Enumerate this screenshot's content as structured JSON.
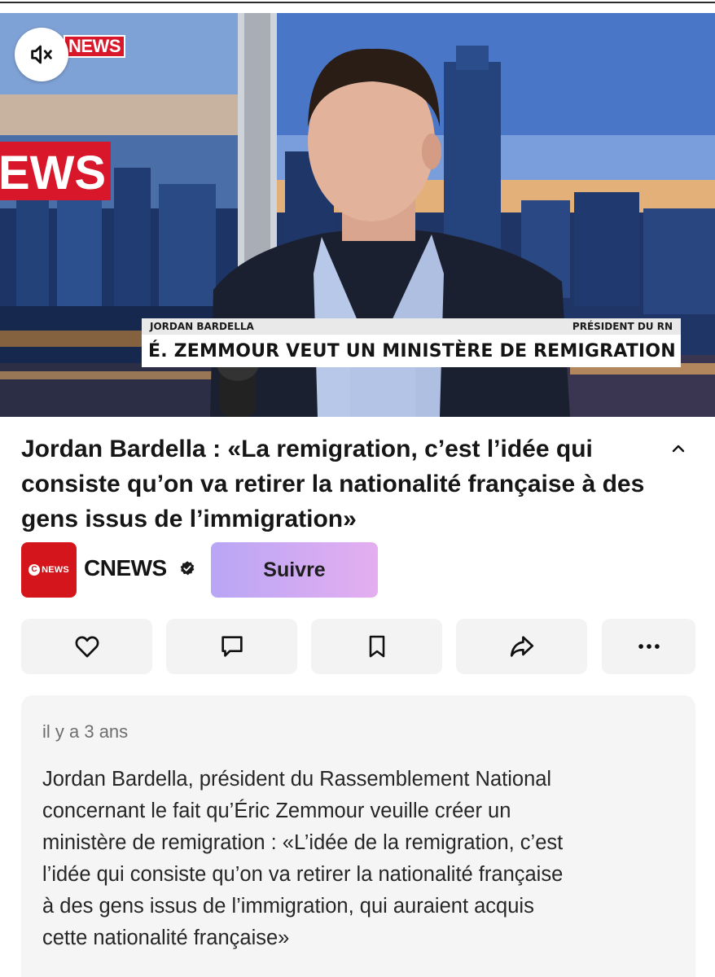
{
  "video": {
    "channel_bug": "NEWS",
    "wall_logo": "EWS",
    "lower_third": {
      "name": "JORDAN BARDELLA",
      "role": "PRÉSIDENT DU RN",
      "headline": "É. ZEMMOUR VEUT UN MINISTÈRE DE REMIGRATION"
    },
    "mute_icon": "speaker-muted-icon"
  },
  "post": {
    "title": "Jordan Bardella : «La remigration, c’est l’idée qui consiste qu’on va retirer la nationalité française à des gens issus de l’immigration»",
    "collapse_icon": "chevron-up-icon"
  },
  "channel": {
    "avatar_text": "NEWS",
    "avatar_letter": "C",
    "name": "CNEWS",
    "verified_icon": "verified-badge-icon",
    "follow_label": "Suivre",
    "brand_color": "#d4161c"
  },
  "actions": [
    {
      "icon": "heart-icon"
    },
    {
      "icon": "comment-icon"
    },
    {
      "icon": "bookmark-icon"
    },
    {
      "icon": "share-icon"
    },
    {
      "icon": "more-icon"
    }
  ],
  "description": {
    "timestamp": "il y a 3 ans",
    "text": "Jordan Bardella, président du Rassemblement National\nconcernant le fait qu’Éric Zemmour veuille créer un\nministère de remigration : «L’idée de la remigration, c’est\nl’idée qui consiste qu’on va retirer la nationalité française\nà des gens issus de l’immigration, qui auraient acquis\ncette nationalité française»"
  }
}
